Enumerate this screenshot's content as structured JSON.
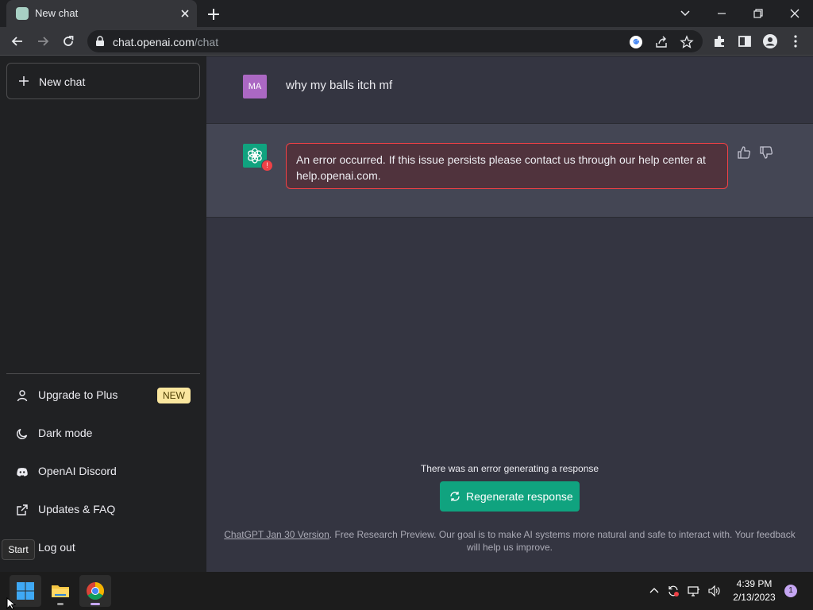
{
  "browser": {
    "tab_title": "New chat",
    "url_host": "chat.openai.com",
    "url_path": "/chat"
  },
  "sidebar": {
    "new_chat_label": "New chat",
    "items": [
      {
        "label": "Upgrade to Plus",
        "icon": "user-icon",
        "badge": "NEW"
      },
      {
        "label": "Dark mode",
        "icon": "moon-icon"
      },
      {
        "label": "OpenAI Discord",
        "icon": "discord-icon"
      },
      {
        "label": "Updates & FAQ",
        "icon": "external-link-icon"
      },
      {
        "label": "Log out",
        "icon": "logout-icon"
      }
    ]
  },
  "conversation": {
    "user_initials": "MA",
    "user_message": "why my balls itch mf",
    "bot_alert_badge": "!",
    "error_message": "An error occurred. If this issue persists please contact us through our help center at help.openai.com."
  },
  "footer": {
    "generation_error": "There was an error generating a response",
    "regenerate_label": "Regenerate response",
    "version_link": "ChatGPT Jan 30 Version",
    "note": ". Free Research Preview. Our goal is to make AI systems more natural and safe to interact with. Your feedback will help us improve."
  },
  "tooltip": {
    "start": "Start"
  },
  "taskbar": {
    "time": "4:39 PM",
    "date": "2/13/2023",
    "notification_count": "1"
  },
  "colors": {
    "accent": "#10a37f",
    "error_border": "#ef4146",
    "user_avatar": "#ab68c3",
    "badge": "#fae69e"
  }
}
